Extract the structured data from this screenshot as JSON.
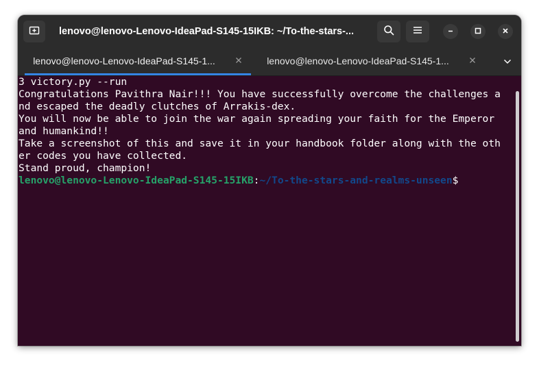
{
  "window": {
    "title": "lenovo@lenovo-Lenovo-IdeaPad-S145-15IKB: ~/To-the-stars-...",
    "background": "#300a24"
  },
  "titlebar": {
    "icons": {
      "new_tab": "new-tab-icon",
      "search": "search-icon",
      "menu": "hamburger-menu-icon",
      "minimize": "minimize-icon",
      "maximize": "maximize-icon",
      "close": "close-icon"
    }
  },
  "tabs": [
    {
      "label": "lenovo@lenovo-Lenovo-IdeaPad-S145-1...",
      "active": true
    },
    {
      "label": "lenovo@lenovo-Lenovo-IdeaPad-S145-1...",
      "active": false
    }
  ],
  "tab_menu_icon": "chevron-down-icon",
  "terminal": {
    "lines": [
      "3 victory.py --run",
      "Congratulations Pavithra Nair!!! You have successfully overcome the challenges a",
      "nd escaped the deadly clutches of Arrakis-dex.",
      "You will now be able to join the war again spreading your faith for the Emperor",
      "and humankind!!",
      "Take a screenshot of this and save it in your handbook folder along with the oth",
      "er codes you have collected.",
      "Stand proud, champion!"
    ],
    "prompt": {
      "user_host": "lenovo@lenovo-Lenovo-IdeaPad-S145-15IKB",
      "colon": ":",
      "path": "~/To-the-stars-and-realms-unseen",
      "symbol": "$"
    }
  },
  "colors": {
    "terminal_bg": "#300a24",
    "prompt_user": "#26a269",
    "prompt_path": "#12488b",
    "accent": "#3584e4"
  }
}
